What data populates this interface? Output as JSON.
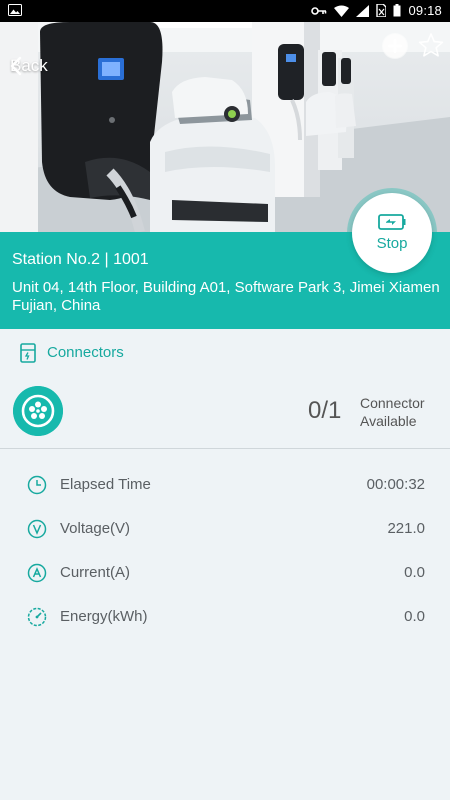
{
  "status_bar": {
    "time": "09:18"
  },
  "header": {
    "back_label": "Back"
  },
  "station": {
    "title": "Station No.2 | 1001",
    "address": "Unit 04, 14th Floor, Building A01, Software Park 3, Jimei Xiamen Fujian, China"
  },
  "stop_button": {
    "label": "Stop"
  },
  "connectors": {
    "section_label": "Connectors",
    "available_count": "0/1",
    "available_text_line1": "Connector",
    "available_text_line2": "Available"
  },
  "metrics": [
    {
      "name": "Elapsed Time",
      "value": "00:00:32",
      "icon": "clock-icon"
    },
    {
      "name": "Voltage(V)",
      "value": "221.0",
      "icon": "voltage-icon"
    },
    {
      "name": "Current(A)",
      "value": "0.0",
      "icon": "current-icon"
    },
    {
      "name": "Energy(kWh)",
      "value": "0.0",
      "icon": "energy-gauge-icon"
    }
  ],
  "colors": {
    "accent": "#17b9ad",
    "accent_text": "#17a99f",
    "background": "#eef3f6"
  }
}
